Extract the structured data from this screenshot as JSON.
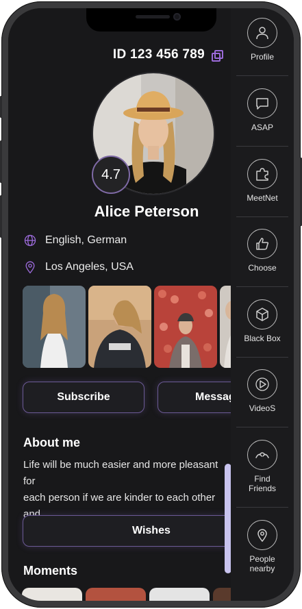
{
  "profile": {
    "id_text": "ID 123 456 789",
    "rating": "4.7",
    "name": "Alice Peterson",
    "languages": "English, German",
    "location": "Los Angeles, USA"
  },
  "actions": {
    "subscribe": "Subscribe",
    "message": "Message",
    "wishes": "Wishes"
  },
  "about": {
    "title": "About me",
    "text": "Life will be much easier and more pleasant for\neach person if we are kinder to each other and\nthe world will be better."
  },
  "moments": {
    "title": "Moments"
  },
  "rail": [
    {
      "label": "Profile",
      "icon": "user-icon"
    },
    {
      "label": "ASAP",
      "icon": "chat-bubble-icon"
    },
    {
      "label": "MeetNet",
      "icon": "puzzle-icon"
    },
    {
      "label": "Choose",
      "icon": "thumbs-up-icon"
    },
    {
      "label": "Black Box",
      "icon": "cube-icon"
    },
    {
      "label": "VideoS",
      "icon": "video-play-icon"
    },
    {
      "label": "Find\nFriends",
      "icon": "friends-icon"
    },
    {
      "label": "People\nnearby",
      "icon": "location-pin-icon"
    }
  ],
  "colors": {
    "accent": "#9b6ad9",
    "border": "#6c5a96",
    "background": "#18181a",
    "scrollbar": "#c8c3ee"
  }
}
